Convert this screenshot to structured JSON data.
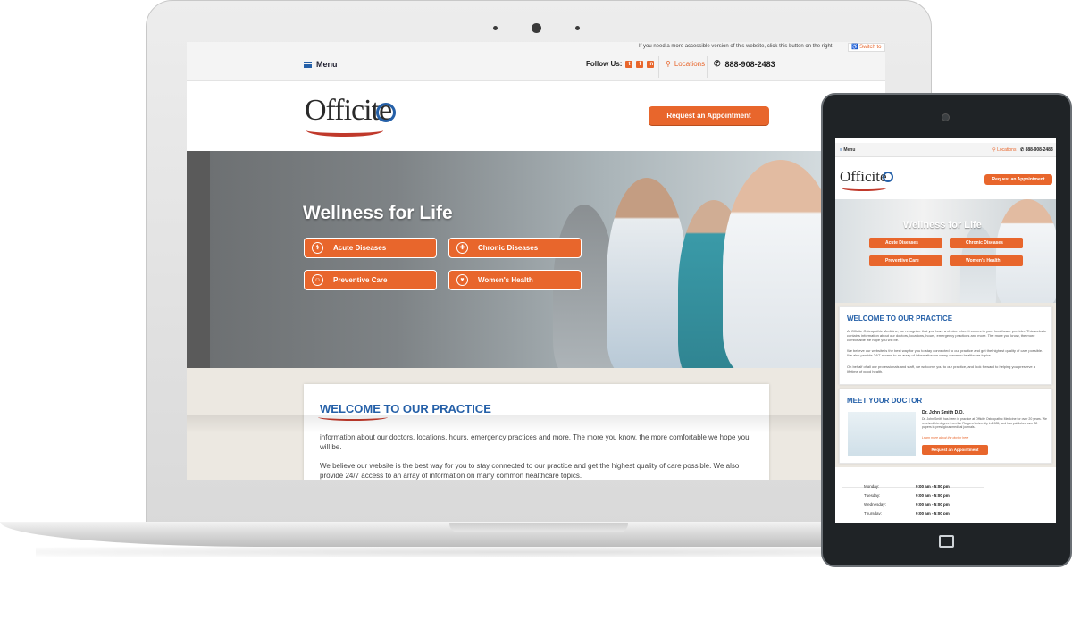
{
  "site": {
    "accessibility_note": "If you need a more accessible version of this website, click this button on the right.",
    "accessibility_button": "Switch to",
    "menu_label": "Menu",
    "follow_label": "Follow Us:",
    "social_icons": [
      "twitter-icon",
      "facebook-icon",
      "linkedin-icon"
    ],
    "locations_label": "Locations",
    "phone": "888-908-2483",
    "logo_text": "Officite",
    "appointment_button": "Request an Appointment",
    "hero_title": "Wellness for Life",
    "hero_buttons": [
      {
        "label": "Acute Diseases",
        "icon": "stethoscope-icon",
        "glyph": "⚕"
      },
      {
        "label": "Chronic Diseases",
        "icon": "medkit-icon",
        "glyph": "✚"
      },
      {
        "label": "Preventive Care",
        "icon": "doctor-icon",
        "glyph": "☺"
      },
      {
        "label": "Women's Health",
        "icon": "heart-icon",
        "glyph": "♥"
      }
    ],
    "welcome_title": "WELCOME TO OUR PRACTICE",
    "welcome_paragraphs": [
      "information about our doctors, locations, hours, emergency practices and more. The more you know, the more comfortable we hope you will be.",
      "We believe our website is the best way for you to stay connected to our practice and get the highest quality of care possible. We also provide 24/7 access to an array of information on many common healthcare topics."
    ]
  },
  "tablet": {
    "menu_label": "Menu",
    "locations_label": "Locations",
    "phone": "888-908-2483",
    "logo_text": "Officite",
    "appointment_button": "Request an Appointment",
    "hero_title": "Wellness for Life",
    "hero_buttons": [
      "Acute Diseases",
      "Chronic Diseases",
      "Preventive Care",
      "Women's Health"
    ],
    "welcome_title": "WELCOME TO OUR PRACTICE",
    "welcome_paragraphs": [
      "At Officite Osteopathic Medicine, we recognize that you have a choice when it comes to your healthcare provider. This website contains information about our doctors, locations, hours, emergency practices and more. The more you know, the more comfortable we hope you will be.",
      "We believe our website is the best way for you to stay connected to our practice and get the highest quality of care possible. We also provide 24/7 access to an array of information on many common healthcare topics.",
      "On behalf of all our professionals and staff, we welcome you to our practice, and look forward to helping you preserve a lifetime of good health."
    ],
    "doctor_title": "MEET YOUR DOCTOR",
    "doctor_name": "Dr. John Smith D.O.",
    "doctor_bio": "Dr. John Smith has been in practice at Officite Osteopathic Medicine for over 20 years. We received his degree from the Rutgers University in 1985, and has published over 30 papers in prestigious medical journals.",
    "doctor_link": "Learn more about the doctor here",
    "doctor_button": "Request an Appointment",
    "hours": [
      {
        "day": "Monday:",
        "time": "9:00 am - 5:00 pm"
      },
      {
        "day": "Tuesday:",
        "time": "9:00 am - 5:00 pm"
      },
      {
        "day": "Wednesday:",
        "time": "9:00 am - 5:00 pm"
      },
      {
        "day": "Thursday:",
        "time": "9:00 am - 5:00 pm"
      }
    ]
  },
  "colors": {
    "accent_orange": "#e8662c",
    "brand_blue": "#2560a8",
    "swoosh_red": "#c0392b",
    "device_frame": "#1f2326"
  }
}
